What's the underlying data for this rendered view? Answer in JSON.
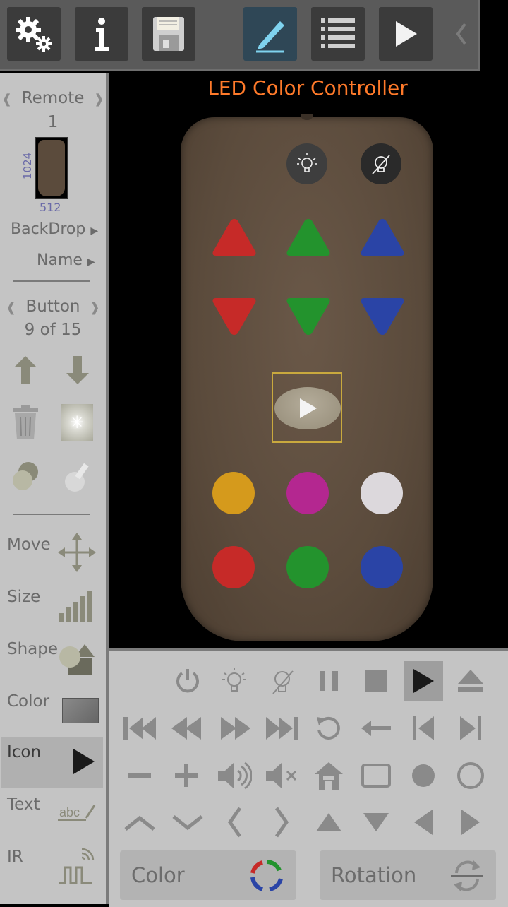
{
  "toolbar": {
    "buttons": [
      {
        "icon": "gears-icon",
        "active": false
      },
      {
        "icon": "info-icon",
        "active": false
      },
      {
        "icon": "floppy-disk-icon",
        "active": false
      },
      {
        "icon": "pencil-icon",
        "active": true
      },
      {
        "icon": "list-icon",
        "active": false
      },
      {
        "icon": "play-icon",
        "active": false
      }
    ],
    "collapse_icon": "chevron-left-icon"
  },
  "left_panel": {
    "remote_label": "Remote",
    "remote_index": "1",
    "thumb_height": "1024",
    "thumb_width": "512",
    "backdrop_label": "BackDrop",
    "name_label": "Name",
    "button_label": "Button",
    "button_index": "9 of 15",
    "tools": [
      {
        "label": "Move",
        "icon": "move-arrows-icon"
      },
      {
        "label": "Size",
        "icon": "size-bars-icon"
      },
      {
        "label": "Shape",
        "icon": "shape-icon"
      },
      {
        "label": "Color",
        "icon": "color-swatch-icon"
      },
      {
        "label": "Icon",
        "icon": "play-icon",
        "selected": true
      },
      {
        "label": "Text",
        "icon": "text-abc-icon"
      },
      {
        "label": "IR",
        "icon": "ir-signal-icon"
      }
    ]
  },
  "remote": {
    "title": "LED Color Controller",
    "colors": {
      "red": "#c62a28",
      "green": "#23932d",
      "blue": "#2a44a6",
      "orange": "#d59a1c",
      "magenta": "#b42790",
      "white": "#dcd8dc",
      "body": "#5b4b3c",
      "title": "#ff7a2a",
      "selection": "#c9a93e"
    }
  },
  "bottom_panel": {
    "selected_icon": "play-icon",
    "icons_rows": [
      [
        "power-icon",
        "bulb-on-icon",
        "bulb-off-icon",
        "pause-icon",
        "stop-icon",
        "play-icon",
        "eject-icon"
      ],
      [
        "skip-back-icon",
        "rewind-icon",
        "fast-forward-icon",
        "skip-forward-icon",
        "refresh-icon",
        "back-arrow-icon",
        "step-back-icon",
        "step-forward-icon"
      ],
      [
        "minus-icon",
        "plus-icon",
        "volume-icon",
        "mute-icon",
        "home-icon",
        "square-outline-icon",
        "circle-filled-icon",
        "circle-outline-icon"
      ],
      [
        "chevron-up-icon",
        "chevron-down-icon",
        "chevron-left-icon",
        "chevron-right-icon",
        "triangle-up-icon",
        "triangle-down-icon",
        "triangle-left-icon",
        "triangle-right-icon"
      ]
    ],
    "color_label": "Color",
    "rotation_label": "Rotation"
  }
}
